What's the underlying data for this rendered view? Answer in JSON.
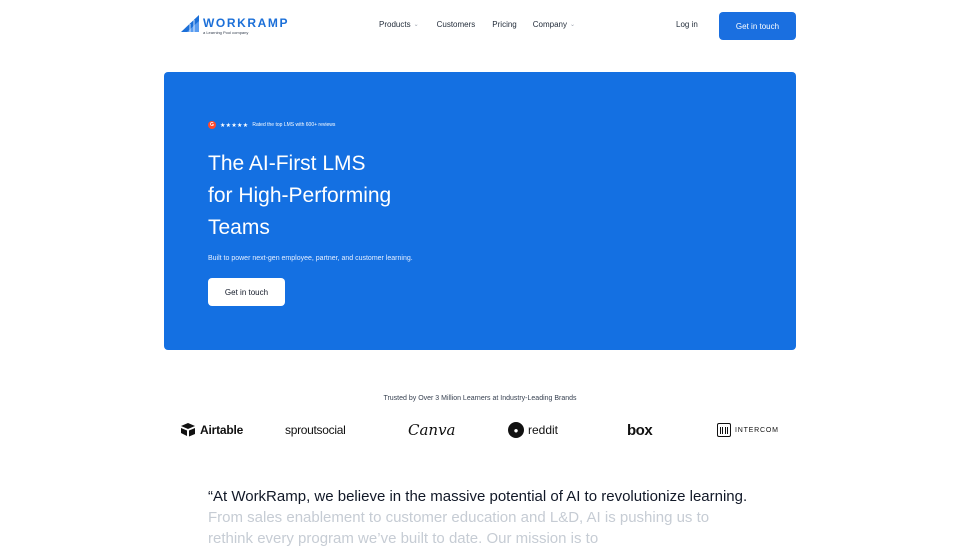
{
  "nav": {
    "logo_word": "WORKRAMP",
    "logo_sub": "a Learning Pool company",
    "links": [
      {
        "label": "Products",
        "has_dropdown": true
      },
      {
        "label": "Customers",
        "has_dropdown": false
      },
      {
        "label": "Pricing",
        "has_dropdown": false
      },
      {
        "label": "Company",
        "has_dropdown": true
      }
    ],
    "login": "Log in",
    "cta": "Get in touch"
  },
  "hero": {
    "rating_badge": "G",
    "stars": "★★★★★",
    "rating_text": "Rated the top LMS with 600+ reviews",
    "title_lines": [
      "The AI-First LMS",
      "for High-Performing",
      "Teams"
    ],
    "subtitle": "Built to power next-gen employee, partner, and customer learning.",
    "cta": "Get in touch"
  },
  "trusted": {
    "heading": "Trusted by Over 3 Million Learners at Industry-Leading Brands",
    "brands": [
      "Airtable",
      "sproutsocial",
      "Canva",
      "reddit",
      "box",
      "INTERCOM"
    ]
  },
  "quote": {
    "visible": "“At WorkRamp, we believe in the massive potential of AI to revolutionize learning.",
    "faded": " From sales enablement to customer education and L&D, AI is pushing us to rethink every program we’ve built to date. Our mission is to"
  },
  "colors": {
    "brand_blue": "#1470e2",
    "cta_blue": "#1a6fe0",
    "g2_red": "#ff492c"
  },
  "icons": [
    "workramp-logo-icon",
    "chevron-down-icon",
    "g2-badge-icon",
    "airtable-logo-icon",
    "reddit-logo-icon",
    "intercom-logo-icon"
  ]
}
